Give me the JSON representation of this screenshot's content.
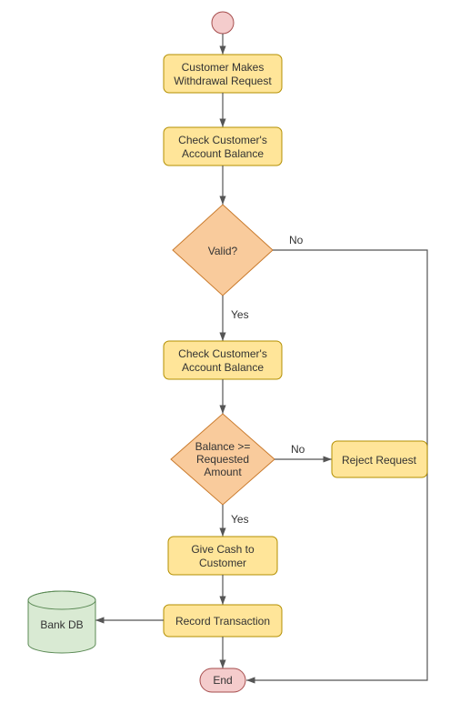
{
  "chart_data": {
    "type": "flowchart",
    "nodes": [
      {
        "id": "start",
        "type": "start-circle",
        "label": ""
      },
      {
        "id": "n1",
        "type": "process",
        "label": "Customer Makes Withdrawal Request"
      },
      {
        "id": "n2",
        "type": "process",
        "label": "Check Customer's Account Balance"
      },
      {
        "id": "d1",
        "type": "decision",
        "label": "Valid?"
      },
      {
        "id": "n3",
        "type": "process",
        "label": "Check Customer's Account Balance"
      },
      {
        "id": "d2",
        "type": "decision",
        "label": "Balance >= Requested Amount"
      },
      {
        "id": "n4",
        "type": "process",
        "label": "Give Cash to Customer"
      },
      {
        "id": "n5",
        "type": "process",
        "label": "Record Transaction"
      },
      {
        "id": "db",
        "type": "database",
        "label": "Bank DB"
      },
      {
        "id": "rej",
        "type": "process",
        "label": "Reject Request"
      },
      {
        "id": "end",
        "type": "end",
        "label": "End"
      }
    ],
    "edges": [
      {
        "from": "start",
        "to": "n1"
      },
      {
        "from": "n1",
        "to": "n2"
      },
      {
        "from": "n2",
        "to": "d1"
      },
      {
        "from": "d1",
        "to": "n3",
        "label": "Yes"
      },
      {
        "from": "d1",
        "to": "rej_path",
        "label": "No"
      },
      {
        "from": "n3",
        "to": "d2"
      },
      {
        "from": "d2",
        "to": "n4",
        "label": "Yes"
      },
      {
        "from": "d2",
        "to": "rej",
        "label": "No"
      },
      {
        "from": "n4",
        "to": "n5"
      },
      {
        "from": "n5",
        "to": "db"
      },
      {
        "from": "n5",
        "to": "end"
      },
      {
        "from": "rej",
        "to": "end"
      }
    ]
  },
  "text": {
    "n1a": "Customer Makes",
    "n1b": "Withdrawal Request",
    "n2a": "Check Customer's",
    "n2b": "Account Balance",
    "d1": "Valid?",
    "n3a": "Check Customer's",
    "n3b": "Account Balance",
    "d2a": "Balance >=",
    "d2b": "Requested",
    "d2c": "Amount",
    "n4a": "Give Cash to",
    "n4b": "Customer",
    "n5": "Record Transaction",
    "rej": "Reject Request",
    "end": "End",
    "db": "Bank DB",
    "yes": "Yes",
    "no": "No"
  }
}
